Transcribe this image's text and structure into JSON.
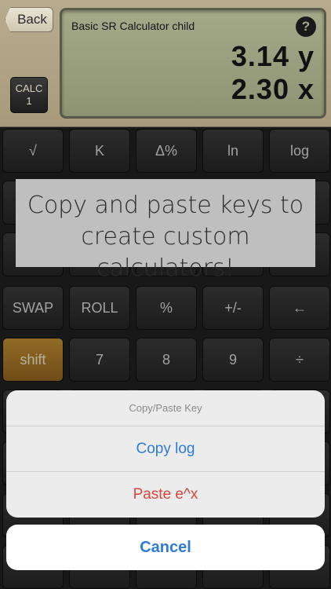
{
  "header": {
    "back_label": "Back",
    "calc_badge": {
      "line1": "CALC",
      "line2": "1"
    },
    "lcd": {
      "title": "Basic SR Calculator child",
      "help_icon": "?",
      "y_value": "3.14 y",
      "x_value": "2.30 x"
    }
  },
  "keys": {
    "row1": [
      "√",
      "K",
      "Δ%",
      "ln",
      "log"
    ],
    "row4": [
      "SWAP",
      "ROLL",
      "%",
      "+/-",
      "←"
    ],
    "row5": [
      "shift",
      "7",
      "8",
      "9",
      "÷"
    ]
  },
  "promo": {
    "line1": "Copy and paste keys to",
    "line2": "create custom calculators!"
  },
  "action_sheet": {
    "title": "Copy/Paste Key",
    "copy_label": "Copy log",
    "paste_label": "Paste e^x",
    "cancel_label": "Cancel"
  },
  "colors": {
    "accent_blue": "#2f7bdc",
    "destructive_red": "#e0463c",
    "shift_gold": "#c28f32"
  }
}
